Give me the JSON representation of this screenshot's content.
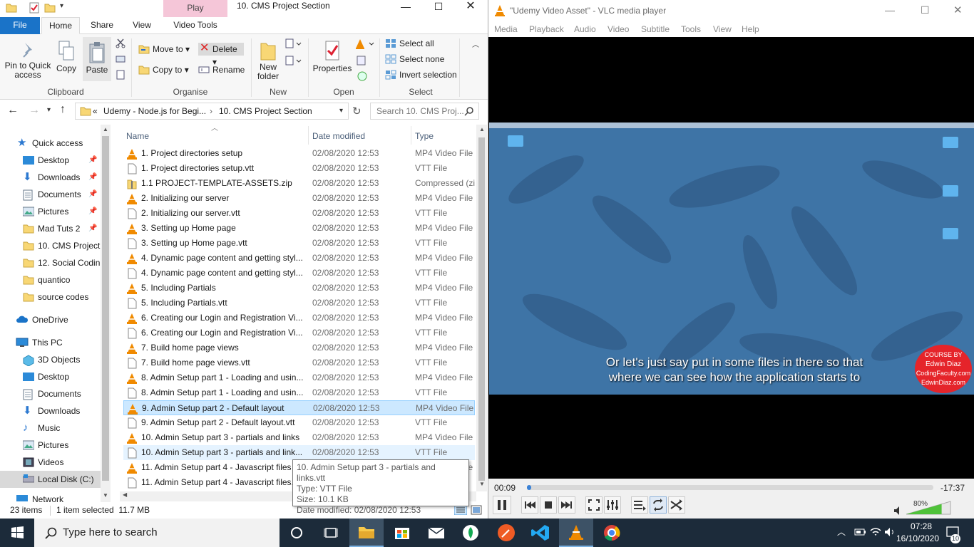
{
  "explorer": {
    "title": "10. CMS Project Section",
    "context_tab": "Play",
    "context_group": "Video Tools",
    "tabs": [
      "File",
      "Home",
      "Share",
      "View"
    ],
    "ribbon": {
      "pin_label": "Pin to Quick access",
      "copy": "Copy",
      "paste": "Paste",
      "clipboard": "Clipboard",
      "move_to": "Move to",
      "copy_to": "Copy to",
      "delete": "Delete",
      "rename": "Rename",
      "organise": "Organise",
      "new_folder": "New folder",
      "new": "New",
      "properties": "Properties",
      "open": "Open",
      "select_all": "Select all",
      "select_none": "Select none",
      "invert_selection": "Invert selection",
      "select": "Select"
    },
    "address": {
      "root": "«",
      "seg1": "Udemy - Node.js for Begi...",
      "seg2": "10. CMS Project Section",
      "search_placeholder": "Search 10. CMS Proj..."
    },
    "nav": {
      "quick_access": "Quick access",
      "desktop": "Desktop",
      "downloads": "Downloads",
      "documents": "Documents",
      "pictures": "Pictures",
      "mad_tuts": "Mad Tuts 2",
      "cms_project": "10. CMS Project",
      "social": "12. Social Codin",
      "quantico": "quantico",
      "source_codes": "source codes",
      "onedrive": "OneDrive",
      "this_pc": "This PC",
      "objects_3d": "3D Objects",
      "pc_desktop": "Desktop",
      "pc_documents": "Documents",
      "pc_downloads": "Downloads",
      "music": "Music",
      "pc_pictures": "Pictures",
      "videos": "Videos",
      "local_disk": "Local Disk (C:)",
      "network": "Network"
    },
    "columns": {
      "name": "Name",
      "date": "Date modified",
      "type": "Type"
    },
    "files": [
      {
        "name": "1. Project directories setup",
        "date": "02/08/2020 12:53",
        "type": "MP4 Video File (VLC)",
        "kind": "vlc"
      },
      {
        "name": "1. Project directories setup.vtt",
        "date": "02/08/2020 12:53",
        "type": "VTT File",
        "kind": "doc"
      },
      {
        "name": "1.1 PROJECT-TEMPLATE-ASSETS.zip",
        "date": "02/08/2020 12:53",
        "type": "Compressed (zipped) Folder",
        "kind": "zip"
      },
      {
        "name": "2. Initializing our server",
        "date": "02/08/2020 12:53",
        "type": "MP4 Video File (VLC)",
        "kind": "vlc"
      },
      {
        "name": "2. Initializing our server.vtt",
        "date": "02/08/2020 12:53",
        "type": "VTT File",
        "kind": "doc"
      },
      {
        "name": "3. Setting up Home page",
        "date": "02/08/2020 12:53",
        "type": "MP4 Video File (VLC)",
        "kind": "vlc"
      },
      {
        "name": "3. Setting up Home page.vtt",
        "date": "02/08/2020 12:53",
        "type": "VTT File",
        "kind": "doc"
      },
      {
        "name": "4. Dynamic page content and getting styl...",
        "date": "02/08/2020 12:53",
        "type": "MP4 Video File (VLC)",
        "kind": "vlc"
      },
      {
        "name": "4. Dynamic page content and getting styl...",
        "date": "02/08/2020 12:53",
        "type": "VTT File",
        "kind": "doc"
      },
      {
        "name": "5. Including Partials",
        "date": "02/08/2020 12:53",
        "type": "MP4 Video File (VLC)",
        "kind": "vlc"
      },
      {
        "name": "5. Including Partials.vtt",
        "date": "02/08/2020 12:53",
        "type": "VTT File",
        "kind": "doc"
      },
      {
        "name": "6. Creating our Login and Registration Vi...",
        "date": "02/08/2020 12:53",
        "type": "MP4 Video File (VLC)",
        "kind": "vlc"
      },
      {
        "name": "6. Creating our Login and Registration Vi...",
        "date": "02/08/2020 12:53",
        "type": "VTT File",
        "kind": "doc"
      },
      {
        "name": "7. Build home page views",
        "date": "02/08/2020 12:53",
        "type": "MP4 Video File (VLC)",
        "kind": "vlc"
      },
      {
        "name": "7. Build home page views.vtt",
        "date": "02/08/2020 12:53",
        "type": "VTT File",
        "kind": "doc"
      },
      {
        "name": "8. Admin Setup part 1 - Loading and usin...",
        "date": "02/08/2020 12:53",
        "type": "MP4 Video File (VLC)",
        "kind": "vlc"
      },
      {
        "name": "8. Admin Setup part 1 - Loading and usin...",
        "date": "02/08/2020 12:53",
        "type": "VTT File",
        "kind": "doc"
      },
      {
        "name": "9. Admin Setup part 2 - Default layout",
        "date": "02/08/2020 12:53",
        "type": "MP4 Video File (VLC)",
        "kind": "vlc",
        "state": "selected"
      },
      {
        "name": "9. Admin Setup part 2 - Default layout.vtt",
        "date": "02/08/2020 12:53",
        "type": "VTT File",
        "kind": "doc"
      },
      {
        "name": "10. Admin Setup part 3 - partials and links",
        "date": "02/08/2020 12:53",
        "type": "MP4 Video File (VLC)",
        "kind": "vlc"
      },
      {
        "name": "10. Admin Setup part 3 - partials and link...",
        "date": "02/08/2020 12:53",
        "type": "VTT File",
        "kind": "doc",
        "state": "hover"
      },
      {
        "name": "11. Admin Setup part 4 - Javascript files",
        "date": "02/08/2020 12:53",
        "type": "MP4 Video File (VLC)",
        "kind": "vlc"
      },
      {
        "name": "11. Admin Setup part 4 - Javascript files.vtt",
        "date": "02/08/2020 12:53",
        "type": "VTT File",
        "kind": "doc"
      }
    ],
    "tooltip": {
      "name": "10. Admin Setup part 3 - partials and links.vtt",
      "type": "Type: VTT File",
      "size": "Size: 10.1 KB",
      "date": "Date modified: 02/08/2020 12:53"
    },
    "status": {
      "items": "23 items",
      "selected": "1 item selected  11.7 MB"
    }
  },
  "vlc": {
    "title": "\"Udemy Video Asset\" - VLC media player",
    "menu": [
      "Media",
      "Playback",
      "Audio",
      "Video",
      "Subtitle",
      "Tools",
      "View",
      "Help"
    ],
    "subtitle_line1": "Or let's just say put in some files in there so that",
    "subtitle_line2": "where we can see how the application starts to",
    "badge": [
      "COURSE BY",
      "Edwin Diaz",
      "CodingFaculty.com",
      "EdwinDiaz.com"
    ],
    "elapsed": "00:09",
    "remaining": "-17:37",
    "progress": 0.01,
    "volume": "80%",
    "volume_level": 0.8
  },
  "taskbar": {
    "search_placeholder": "Type here to search",
    "time": "07:28",
    "date": "16/10/2020",
    "notifications": "10"
  },
  "colors": {
    "file_tab": "#1a73c8",
    "selection": "#cce8ff",
    "vlc_orange": "#f08a00",
    "taskbar": "#1c2b3a"
  }
}
